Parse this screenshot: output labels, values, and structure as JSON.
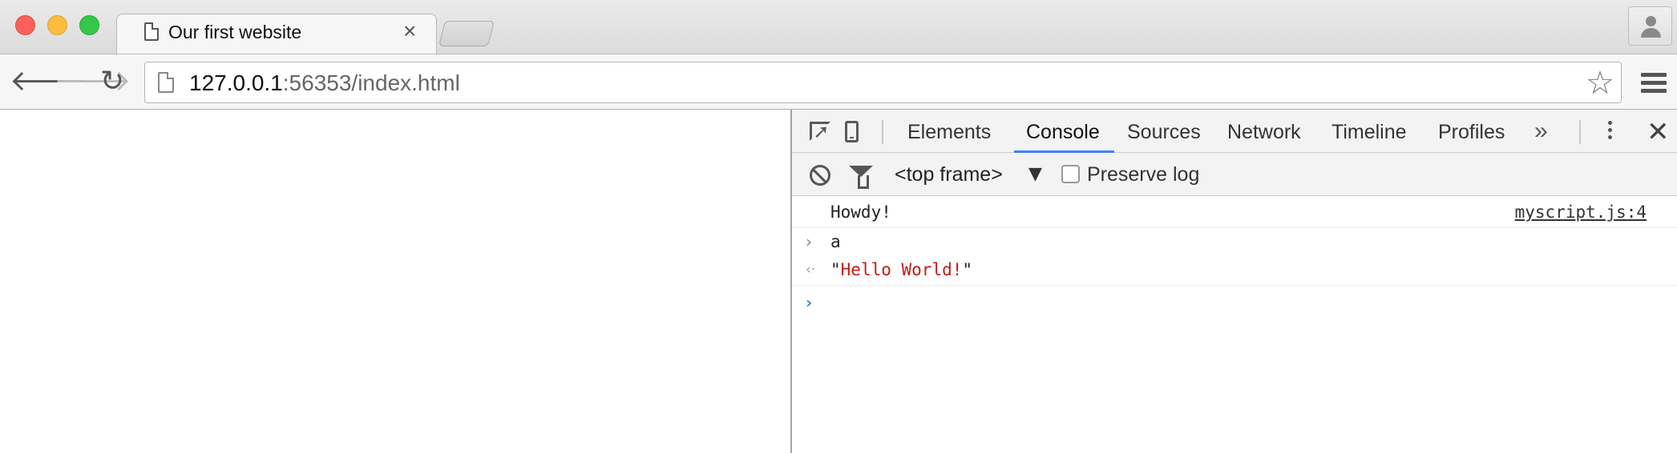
{
  "browser": {
    "tab_title": "Our first website",
    "tab_close": "×",
    "address_host": "127.0.0.1",
    "address_rest": ":56353/index.html",
    "icons": {
      "back": "arrow-left",
      "forward": "arrow-right",
      "reload": "reload",
      "bookmark": "star",
      "menu": "hamburger",
      "profile": "person"
    }
  },
  "devtools": {
    "tabs": [
      {
        "label": "Elements",
        "active": false
      },
      {
        "label": "Console",
        "active": true
      },
      {
        "label": "Sources",
        "active": false
      },
      {
        "label": "Network",
        "active": false
      },
      {
        "label": "Timeline",
        "active": false
      },
      {
        "label": "Profiles",
        "active": false
      }
    ],
    "more_tabs": "»",
    "close": "✕",
    "accent_color": "#3e82f7",
    "filterbar": {
      "frame_select": "<top frame>",
      "frame_arrow": "▼",
      "preserve_log_label": "Preserve log",
      "preserve_log_checked": false
    },
    "console": {
      "log_message": "Howdy!",
      "log_source": "myscript.js:4",
      "input_glyph": "›",
      "input_expr": "a",
      "result_glyph": "‹·",
      "result_quote_open": "\"",
      "result_value": "Hello World!",
      "result_quote_close": "\"",
      "prompt_glyph": "›",
      "string_color": "#c41a16",
      "prompt_color": "#3e82f7"
    }
  }
}
